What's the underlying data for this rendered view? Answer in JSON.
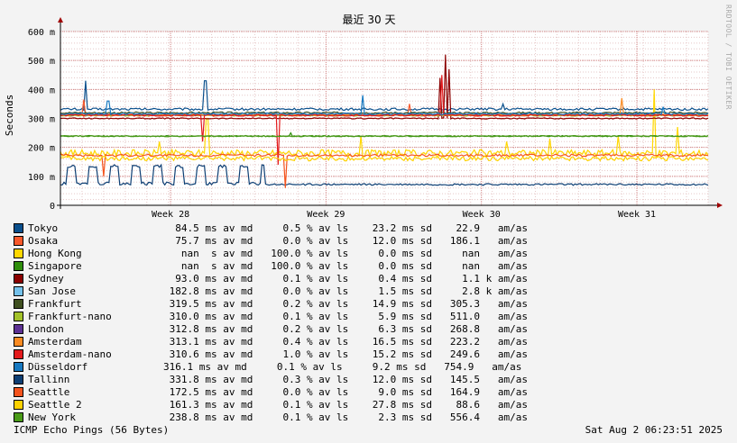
{
  "chart_data": {
    "type": "line",
    "title": "最近 30 天",
    "ylabel": "Seconds",
    "ylim": [
      0,
      0.6
    ],
    "yticks": [
      {
        "v": 0,
        "label": "0"
      },
      {
        "v": 0.1,
        "label": "100 m"
      },
      {
        "v": 0.2,
        "label": "200 m"
      },
      {
        "v": 0.3,
        "label": "300 m"
      },
      {
        "v": 0.4,
        "label": "400 m"
      },
      {
        "v": 0.5,
        "label": "500 m"
      },
      {
        "v": 0.6,
        "label": "600 m"
      }
    ],
    "xlim": [
      0,
      30
    ],
    "xticks": [
      {
        "v": 5.1,
        "label": "Week 28"
      },
      {
        "v": 12.3,
        "label": "Week 29"
      },
      {
        "v": 19.5,
        "label": "Week 30"
      },
      {
        "v": 26.7,
        "label": "Week 31"
      }
    ],
    "grid": true,
    "series": [
      {
        "name": "Tokyo",
        "color": "#0A4F8C",
        "avg": 0.3319,
        "noise": 0.004,
        "spikes": [
          [
            1.2,
            0.43
          ],
          [
            6.7,
            0.43
          ],
          [
            20.5,
            0.35
          ]
        ]
      },
      {
        "name": "Osaka",
        "color": "#F9582B",
        "avg": 0.3105,
        "noise": 0.003,
        "spikes": [
          [
            1.1,
            0.365
          ],
          [
            16.2,
            0.35
          ]
        ]
      },
      {
        "name": "Hong Kong",
        "color": "#FFD700",
        "avg": 0.18,
        "noise": 0.012,
        "spikes": [
          [
            4.6,
            0.22
          ],
          [
            6.8,
            0.3
          ],
          [
            13.9,
            0.24
          ],
          [
            20.7,
            0.22
          ],
          [
            22.7,
            0.23
          ],
          [
            25.8,
            0.24
          ],
          [
            27.5,
            0.4
          ],
          [
            28.6,
            0.27
          ]
        ]
      },
      {
        "name": "Singapore",
        "color": "#2F8E0B",
        "avg": 0.2388,
        "noise": 0.002,
        "spikes": [
          [
            10.7,
            0.25
          ]
        ]
      },
      {
        "name": "Sydney",
        "color": "#8B0000",
        "avg": 0.3,
        "noise": 0.002,
        "spikes": [
          [
            17.6,
            0.44
          ],
          [
            17.8,
            0.52
          ],
          [
            18.0,
            0.47
          ]
        ]
      },
      {
        "name": "San Jose",
        "color": "#74C1EB",
        "avg": 0.3128,
        "noise": 0.002,
        "spikes": []
      },
      {
        "name": "Frankfurt",
        "color": "#3F4F1F",
        "avg": 0.3195,
        "noise": 0.003,
        "spikes": []
      },
      {
        "name": "Frankfurt-nano",
        "color": "#A3C22A",
        "avg": 0.31,
        "noise": 0.002,
        "spikes": []
      },
      {
        "name": "London",
        "color": "#5D3194",
        "avg": 0.3128,
        "noise": 0.002,
        "spikes": []
      },
      {
        "name": "Amsterdam",
        "color": "#FB8B22",
        "avg": 0.3131,
        "noise": 0.003,
        "spikes": [
          [
            26.0,
            0.37
          ]
        ]
      },
      {
        "name": "Amsterdam-nano",
        "color": "#E31A1C",
        "avg": 0.3106,
        "noise": 0.003,
        "spikes": [
          [
            6.6,
            0.22
          ],
          [
            10.1,
            0.14
          ],
          [
            17.7,
            0.45
          ]
        ]
      },
      {
        "name": "Düsseldorf",
        "color": "#1779C1",
        "avg": 0.3161,
        "noise": 0.003,
        "spikes": [
          [
            2.2,
            0.36
          ],
          [
            14.0,
            0.38
          ],
          [
            27.9,
            0.34
          ]
        ]
      },
      {
        "name": "Tallinn",
        "color": "#0E3F74",
        "avg": 0.072,
        "noise": 0.003,
        "spikes": [],
        "wave": true
      },
      {
        "name": "Seattle",
        "color": "#F4531D",
        "avg": 0.1725,
        "noise": 0.004,
        "spikes": [
          [
            2.0,
            0.1
          ],
          [
            10.4,
            0.06
          ]
        ]
      },
      {
        "name": "Seattle 2",
        "color": "#FDD100",
        "avg": 0.1613,
        "noise": 0.008,
        "spikes": []
      },
      {
        "name": "New York",
        "color": "#4A9B18",
        "avg": 0.2388,
        "noise": 0.002,
        "spikes": []
      }
    ]
  },
  "legend": [
    {
      "name": "Tokyo",
      "color": "#0A4F8C",
      "stats": "  84.5 ms av md     0.5 % av ls    23.2 ms sd    22.9   am/as"
    },
    {
      "name": "Osaka",
      "color": "#F9582B",
      "stats": "  75.7 ms av md     0.0 % av ls    12.0 ms sd   186.1   am/as"
    },
    {
      "name": "Hong Kong",
      "color": "#FFD700",
      "stats": "   nan  s av md   100.0 % av ls     0.0 ms sd     nan   am/as"
    },
    {
      "name": "Singapore",
      "color": "#2F8E0B",
      "stats": "   nan  s av md   100.0 % av ls     0.0 ms sd     nan   am/as"
    },
    {
      "name": "Sydney",
      "color": "#8B0000",
      "stats": "  93.0 ms av md     0.1 % av ls     0.4 ms sd     1.1 k am/as"
    },
    {
      "name": "San Jose",
      "color": "#74C1EB",
      "stats": " 182.8 ms av md     0.0 % av ls     1.5 ms sd     2.8 k am/as"
    },
    {
      "name": "Frankfurt",
      "color": "#3F4F1F",
      "stats": " 319.5 ms av md     0.2 % av ls    14.9 ms sd   305.3   am/as"
    },
    {
      "name": "Frankfurt-nano",
      "color": "#A3C22A",
      "stats": " 310.0 ms av md     0.1 % av ls     5.9 ms sd   511.0   am/as"
    },
    {
      "name": "London",
      "color": "#5D3194",
      "stats": " 312.8 ms av md     0.2 % av ls     6.3 ms sd   268.8   am/as"
    },
    {
      "name": "Amsterdam",
      "color": "#FB8B22",
      "stats": " 313.1 ms av md     0.4 % av ls    16.5 ms sd   223.2   am/as"
    },
    {
      "name": "Amsterdam-nano",
      "color": "#E31A1C",
      "stats": " 310.6 ms av md     1.0 % av ls    15.2 ms sd   249.6   am/as"
    },
    {
      "name": "Düsseldorf",
      "color": "#1779C1",
      "stats": "316.1 ms av md     0.1 % av ls     9.2 ms sd   754.9   am/as"
    },
    {
      "name": "Tallinn",
      "color": "#0E3F74",
      "stats": " 331.8 ms av md     0.3 % av ls    12.0 ms sd   145.5   am/as"
    },
    {
      "name": "Seattle",
      "color": "#F4531D",
      "stats": " 172.5 ms av md     0.0 % av ls     9.0 ms sd   164.9   am/as"
    },
    {
      "name": "Seattle 2",
      "color": "#FDD100",
      "stats": " 161.3 ms av md     0.1 % av ls    27.8 ms sd    88.6   am/as"
    },
    {
      "name": "New York",
      "color": "#4A9B18",
      "stats": " 238.8 ms av md     0.1 % av ls     2.3 ms sd   556.4   am/as"
    }
  ],
  "footer": {
    "left": "ICMP Echo Pings (56 Bytes)",
    "right": "Sat Aug  2 06:23:51 2025"
  },
  "side_label": "RRDTOOL / TOBI OETIKER"
}
